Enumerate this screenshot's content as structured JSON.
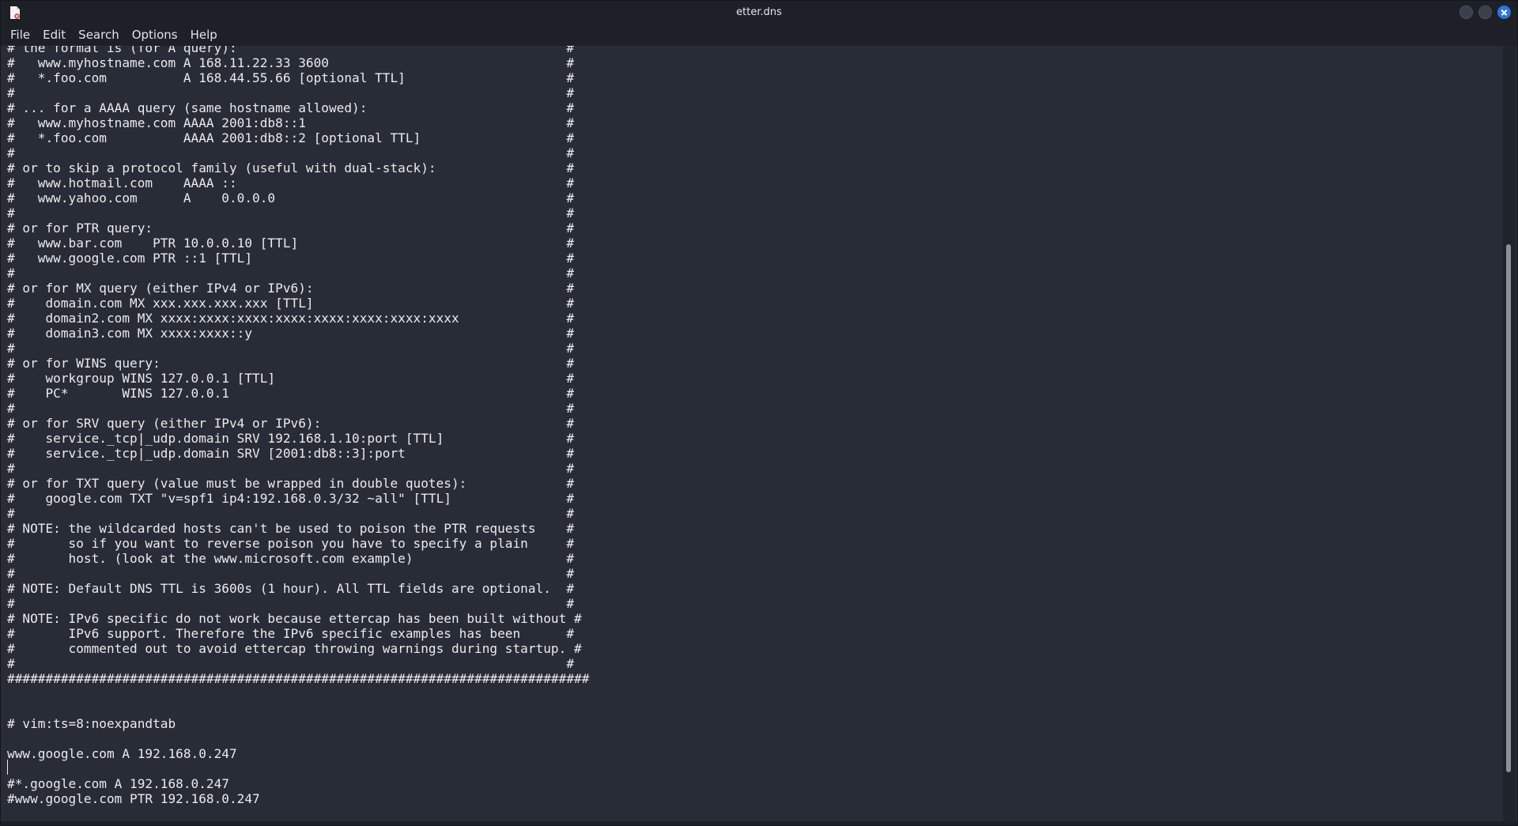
{
  "window": {
    "title": "etter.dns"
  },
  "menu": {
    "items": [
      "File",
      "Edit",
      "Search",
      "Options",
      "Help"
    ]
  },
  "editor": {
    "lines": [
      "# the format is (for A query):                                           #",
      "#   www.myhostname.com A 168.11.22.33 3600                               #",
      "#   *.foo.com          A 168.44.55.66 [optional TTL]                     #",
      "#                                                                        #",
      "# ... for a AAAA query (same hostname allowed):                          #",
      "#   www.myhostname.com AAAA 2001:db8::1                                  #",
      "#   *.foo.com          AAAA 2001:db8::2 [optional TTL]                   #",
      "#                                                                        #",
      "# or to skip a protocol family (useful with dual-stack):                 #",
      "#   www.hotmail.com    AAAA ::                                           #",
      "#   www.yahoo.com      A    0.0.0.0                                      #",
      "#                                                                        #",
      "# or for PTR query:                                                      #",
      "#   www.bar.com    PTR 10.0.0.10 [TTL]                                   #",
      "#   www.google.com PTR ::1 [TTL]                                         #",
      "#                                                                        #",
      "# or for MX query (either IPv4 or IPv6):                                 #",
      "#    domain.com MX xxx.xxx.xxx.xxx [TTL]                                 #",
      "#    domain2.com MX xxxx:xxxx:xxxx:xxxx:xxxx:xxxx:xxxx:xxxx              #",
      "#    domain3.com MX xxxx:xxxx::y                                         #",
      "#                                                                        #",
      "# or for WINS query:                                                     #",
      "#    workgroup WINS 127.0.0.1 [TTL]                                      #",
      "#    PC*       WINS 127.0.0.1                                            #",
      "#                                                                        #",
      "# or for SRV query (either IPv4 or IPv6):                                #",
      "#    service._tcp|_udp.domain SRV 192.168.1.10:port [TTL]                #",
      "#    service._tcp|_udp.domain SRV [2001:db8::3]:port                     #",
      "#                                                                        #",
      "# or for TXT query (value must be wrapped in double quotes):             #",
      "#    google.com TXT \"v=spf1 ip4:192.168.0.3/32 ~all\" [TTL]               #",
      "#                                                                        #",
      "# NOTE: the wildcarded hosts can't be used to poison the PTR requests    #",
      "#       so if you want to reverse poison you have to specify a plain     #",
      "#       host. (look at the www.microsoft.com example)                    #",
      "#                                                                        #",
      "# NOTE: Default DNS TTL is 3600s (1 hour). All TTL fields are optional.  #",
      "#                                                                        #",
      "# NOTE: IPv6 specific do not work because ettercap has been built without #",
      "#       IPv6 support. Therefore the IPv6 specific examples has been      #",
      "#       commented out to avoid ettercap throwing warnings during startup. #",
      "#                                                                        #",
      "############################################################################",
      "",
      "",
      "# vim:ts=8:noexpandtab",
      "",
      "www.google.com A 192.168.0.247",
      "",
      "#*.google.com A 192.168.0.247",
      "#www.google.com PTR 192.168.0.247"
    ]
  },
  "scrollbar": {
    "position": 0.8,
    "visible_fraction": 0.68
  }
}
